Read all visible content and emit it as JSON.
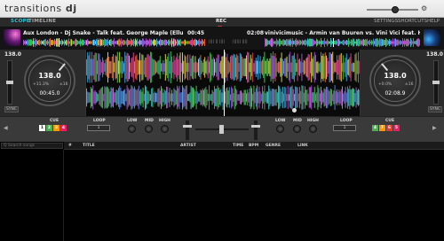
{
  "app": {
    "logo_light": "transitions",
    "logo_bold": "dj"
  },
  "nav": {
    "tabs": [
      {
        "label": "SCOPE"
      },
      {
        "label": "TIMELINE"
      }
    ],
    "rec_label": "REC",
    "settings_label": "SETTINGS",
    "shortcuts_label": "SHORTCUTS",
    "help_label": "HELP",
    "zoom_label": "⚙"
  },
  "deck_left": {
    "track": "Aux London - Dj Snake - Talk feat. George Maple (Ellusive & TRINIX",
    "time": "00:45",
    "tempo_top": "138.0",
    "bpm": "138.0",
    "pitch_low": "+11.3%",
    "pitch_high": "±16",
    "time_big": "00:45.0",
    "sync": "SYNC",
    "mini_a": "||||  ||  ||||",
    "mini_b": "||||||  ||||"
  },
  "deck_right": {
    "track": "vinivicimusic - Armin van Buuren vs. Vini Vici feat. Hilight Tribe - G",
    "time": "02:08",
    "tempo_top": "138.0",
    "bpm": "138.0",
    "pitch_low": "+0.0%",
    "pitch_high": "±16",
    "time_big": "02:08.9",
    "sync": "SYNC"
  },
  "mixer": {
    "cue_label": "CUE",
    "loop_label": "LOOP",
    "low_label": "LOW",
    "mid_label": "MID",
    "high_label": "HIGH",
    "loop_value": "1",
    "left_pads": [
      "1",
      "2",
      "3",
      "4"
    ],
    "right_pads": [
      "4",
      "7",
      "6",
      "5"
    ],
    "left_pad_colors": [
      "#ffffff",
      "#4caf50",
      "#ff9800",
      "#e91e63"
    ],
    "right_pad_colors": [
      "#4caf50",
      "#ff9800",
      "#e53935",
      "#e91e63"
    ]
  },
  "library": {
    "search_placeholder": "Q  Search songs",
    "columns": {
      "num": "#",
      "title": "TITLE",
      "artist": "ARTIST",
      "time": "TIME",
      "bpm": "BPM",
      "genre": "GENRE",
      "link": "LINK"
    }
  }
}
